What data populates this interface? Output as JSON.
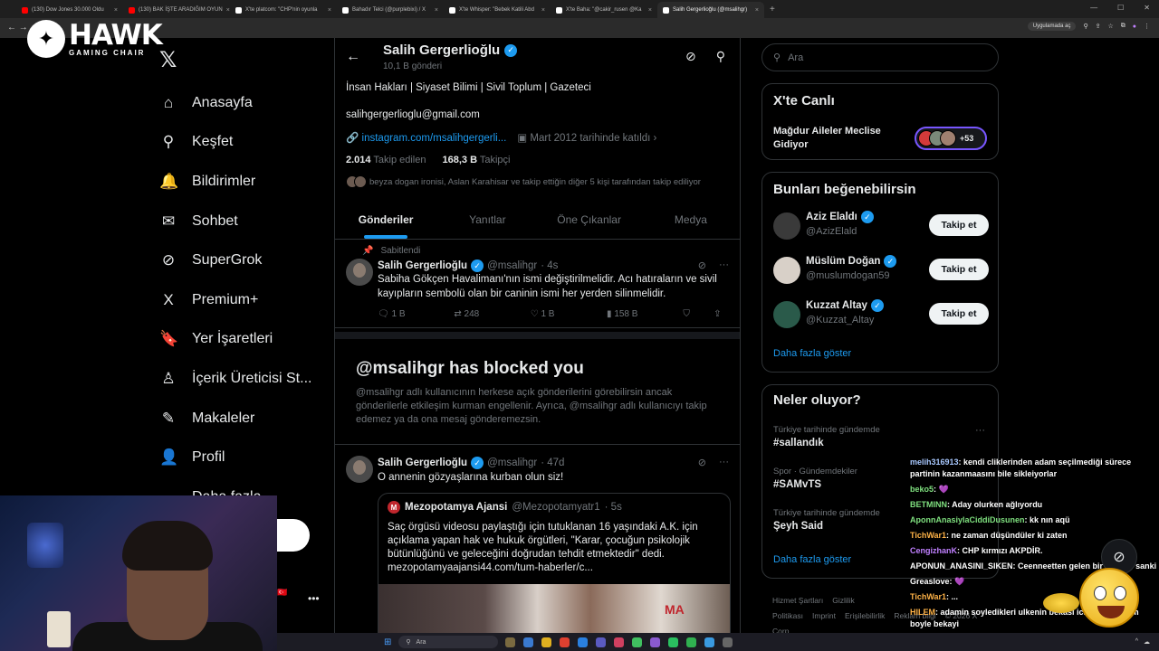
{
  "browser": {
    "tabs": [
      {
        "label": "(130) Dow Jones 30.000 Oldu",
        "color": "#ff0000"
      },
      {
        "label": "(130) BAK İŞTE ARADIĞIM OYUN",
        "color": "#ff0000"
      },
      {
        "label": "X'te platcom: \"CHP'nin oyunla",
        "color": "#ffffff"
      },
      {
        "label": "Bahadır Telci (@purplebixi) / X",
        "color": "#ffffff"
      },
      {
        "label": "X'te Whisper: \"Bebek Katili Abd",
        "color": "#ffffff"
      },
      {
        "label": "X'te Baha: \"@cakir_rusen @Ka",
        "color": "#ffffff"
      },
      {
        "label": "Salih Gergerlioğlu (@msalihgr)",
        "color": "#ffffff",
        "active": true
      }
    ],
    "tab_close": "×",
    "new_tab": "+",
    "incognito_label": "Uygulamada aç"
  },
  "overlay_logo": {
    "brand": "HAWK",
    "tagline": "GAMING CHAIR"
  },
  "nav": {
    "items": [
      {
        "label": "Anasayfa",
        "icon": "⌂"
      },
      {
        "label": "Keşfet",
        "icon": "⚲"
      },
      {
        "label": "Bildirimler",
        "icon": "🔔"
      },
      {
        "label": "Sohbet",
        "icon": "✉"
      },
      {
        "label": "SuperGrok",
        "icon": "⊘"
      },
      {
        "label": "Premium+",
        "icon": "X"
      },
      {
        "label": "Yer İşaretleri",
        "icon": "🔖"
      },
      {
        "label": "İçerik Üreticisi St...",
        "icon": "♙"
      },
      {
        "label": "Makaleler",
        "icon": "✎"
      },
      {
        "label": "Profil",
        "icon": "👤"
      },
      {
        "label": "Daha fazla",
        "icon": "⋯"
      }
    ]
  },
  "profile": {
    "name": "Salih Gergerlioğlu",
    "post_count": "10,1 B gönderi",
    "bio": "İnsan Hakları | Siyaset Bilimi | Sivil Toplum | Gazeteci",
    "email": "salihgergerlioglu@gmail.com",
    "link": "instagram.com/msalihgergerli...",
    "joined": "Mart 2012 tarihinde katıldı",
    "following_count": "2.014",
    "following_label": "Takip edilen",
    "followers_count": "168,3 B",
    "followers_label": "Takipçi",
    "mutual": "beyza dogan ironisi, Aslan Karahisar ve takip ettiğin diğer 5 kişi tarafından takip ediliyor"
  },
  "tabs": [
    "Gönderiler",
    "Yanıtlar",
    "Öne Çıkanlar",
    "Medya"
  ],
  "pinned_post": {
    "pinned_label": "Sabitlendi",
    "author": "Salih Gergerlioğlu",
    "handle": "@msalihgr",
    "time": "· 4s",
    "text": "Sabiha Gökçen Havalimanı'nın ismi değiştirilmelidir. Acı hatıraların ve sivil kayıpların sembolü olan bir caninin ismi her yerden silinmelidir.",
    "replies": "1 B",
    "reposts": "248",
    "likes": "1 B",
    "views": "158 B"
  },
  "blocked": {
    "title": "@msalihgr has blocked you",
    "text": "@msalihgr adlı kullanıcının herkese açık gönderilerini görebilirsin ancak gönderilerle etkileşim kurman engellenir. Ayrıca, @msalihgr adlı kullanıcıyı takip edemez ya da ona mesaj gönderemezsin."
  },
  "post2": {
    "author": "Salih Gergerlioğlu",
    "handle": "@msalihgr",
    "time": "· 47d",
    "text": "O annenin gözyaşlarına kurban olun siz!",
    "quote": {
      "author": "Mezopotamya Ajansi",
      "handle": "@Mezopotamyatr1",
      "time": "· 5s",
      "text": "Saç örgüsü videosu paylaştığı için tutuklanan 16 yaşındaki A.K. için açıklama yapan hak ve hukuk örgütleri, \"Karar, çocuğun psikolojik bütünlüğünü ve geleceğini doğrudan tehdit etmektedir\" dedi. mezopotamyaajansi44.com/tum-haberler/c..."
    }
  },
  "search": {
    "placeholder": "Ara"
  },
  "live": {
    "title": "X'te Canlı",
    "event": "Mağdur Aileler Meclise Gidiyor",
    "count": "+53"
  },
  "suggestions": {
    "title": "Bunları beğenebilirsin",
    "follow_label": "Takip et",
    "people": [
      {
        "name": "Aziz Elaldı",
        "handle": "@AzizElald"
      },
      {
        "name": "Müslüm Doğan",
        "handle": "@muslumdogan59"
      },
      {
        "name": "Kuzzat Altay",
        "handle": "@Kuzzat_Altay"
      }
    ],
    "more": "Daha fazla göster"
  },
  "trends": {
    "title": "Neler oluyor?",
    "items": [
      {
        "category": "Türkiye tarihinde gündemde",
        "topic": "#sallandık"
      },
      {
        "category": "Spor · Gündemdekiler",
        "topic": "#SAMvTS"
      },
      {
        "category": "Türkiye tarihinde gündemde",
        "topic": "Şeyh Said"
      }
    ],
    "more": "Daha fazla göster"
  },
  "footer": [
    "Hizmet Şartları",
    "Gizlilik Politikası",
    "Imprint",
    "Erişilebilirlik",
    "Reklam bilgi",
    "© 2026 X Corp."
  ],
  "chat": [
    {
      "user": "melih316913",
      "color": "#a8c8ff",
      "msg": ": kendi cliklerinden adam seçilmediği sürece partinin kazanmaasını bile sikleiyorlar"
    },
    {
      "user": "beko5",
      "color": "#7fe07f",
      "msg": ": 💜"
    },
    {
      "user": "BETMINN",
      "color": "#7fe07f",
      "msg": ": Aday olurken ağlıyordu"
    },
    {
      "user": "AponnAnasiylaCiddiDusunen",
      "color": "#7fe07f",
      "msg": ": kk nın aqü"
    },
    {
      "user": "TichWar1",
      "color": "#ffb347",
      "msg": ": ne zaman düşündüler ki zaten"
    },
    {
      "user": "CengizhanK",
      "color": "#c080ff",
      "msg": ": CHP kırmızı AKPDİR."
    },
    {
      "user": "APONUN_ANASINI_SIKEN",
      "color": "#ffffff",
      "msg": ": Ceenneetten gelen bir melekti sanki"
    },
    {
      "user": "Greaslove",
      "color": "#ffffff",
      "msg": ": 💜"
    },
    {
      "user": "TichWar1",
      "color": "#ffb347",
      "msg": ": ..."
    },
    {
      "user": "HILEM",
      "color": "#ffb347",
      "msg": ": adamin soyledikleri ulkenin bekasi icin ise, sikeyim boyle bekayi"
    }
  ],
  "taskbar": {
    "search": "Ara"
  }
}
